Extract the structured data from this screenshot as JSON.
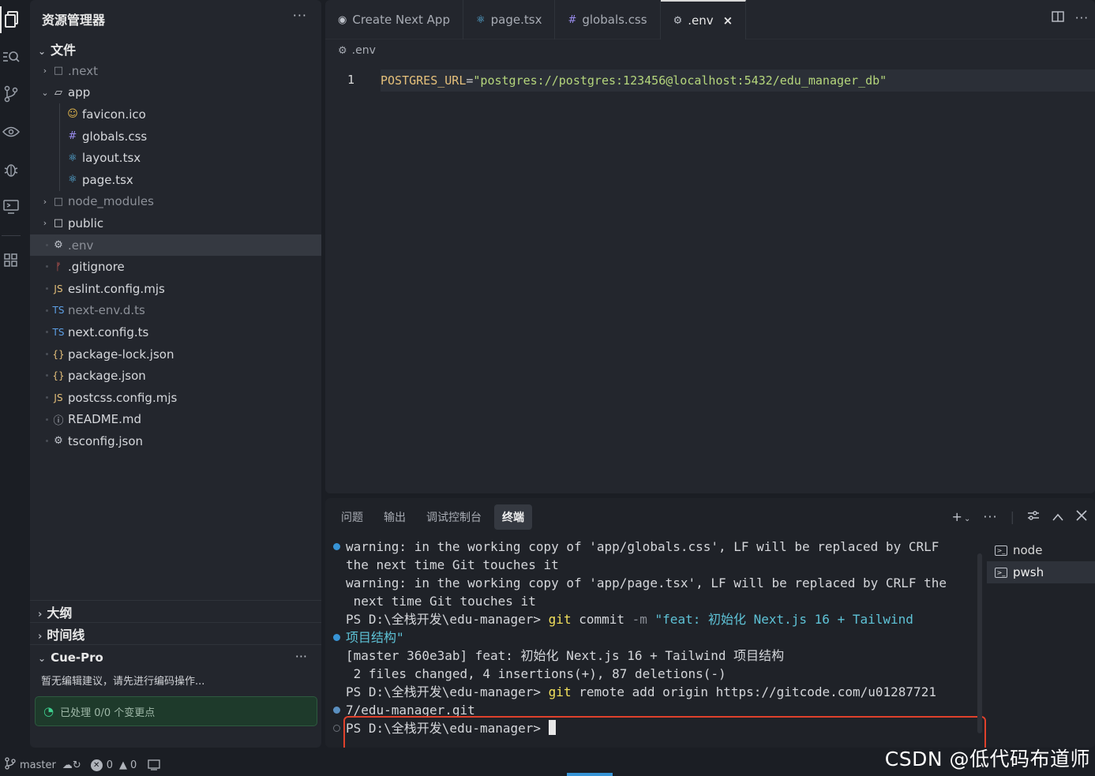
{
  "sidebar": {
    "title": "资源管理器",
    "more": "···",
    "section": "文件",
    "items": [
      {
        "name": "tree-folder-next",
        "label": ".next",
        "icon": "□",
        "chev": "›",
        "indent": 0,
        "dim": true
      },
      {
        "name": "tree-folder-app",
        "label": "app",
        "icon": "▱",
        "chev": "⌄",
        "indent": 0
      },
      {
        "name": "tree-file-favicon",
        "label": "favicon.ico",
        "icon": "☺",
        "iconColor": "#e5b84c",
        "indent": 1
      },
      {
        "name": "tree-file-globals",
        "label": "globals.css",
        "icon": "#",
        "iconColor": "#9b8df0",
        "indent": 1
      },
      {
        "name": "tree-file-layout",
        "label": "layout.tsx",
        "icon": "⚛",
        "iconColor": "#5ec2f6",
        "indent": 1
      },
      {
        "name": "tree-file-page",
        "label": "page.tsx",
        "icon": "⚛",
        "iconColor": "#5ec2f6",
        "indent": 1
      },
      {
        "name": "tree-folder-node-modules",
        "label": "node_modules",
        "icon": "□",
        "chev": "›",
        "indent": 0,
        "dim": true
      },
      {
        "name": "tree-folder-public",
        "label": "public",
        "icon": "□",
        "chev": "›",
        "indent": 0
      },
      {
        "name": "tree-file-env",
        "label": ".env",
        "icon": "⚙",
        "iconColor": "#c0c4cc",
        "indent": 0,
        "dim": true,
        "selected": true
      },
      {
        "name": "tree-file-gitignore",
        "label": ".gitignore",
        "icon": "ᚠ",
        "iconColor": "#e0605a",
        "indent": 0
      },
      {
        "name": "tree-file-eslint",
        "label": "eslint.config.mjs",
        "icon": "JS",
        "iconColor": "#e5c07b",
        "indent": 0
      },
      {
        "name": "tree-file-next-env",
        "label": "next-env.d.ts",
        "icon": "TS",
        "iconColor": "#5ea0e6",
        "indent": 0,
        "dim": true
      },
      {
        "name": "tree-file-next-config",
        "label": "next.config.ts",
        "icon": "TS",
        "iconColor": "#5ea0e6",
        "indent": 0
      },
      {
        "name": "tree-file-package-lock",
        "label": "package-lock.json",
        "icon": "{}",
        "iconColor": "#e5c07b",
        "indent": 0
      },
      {
        "name": "tree-file-package",
        "label": "package.json",
        "icon": "{}",
        "iconColor": "#e5c07b",
        "indent": 0
      },
      {
        "name": "tree-file-postcss",
        "label": "postcss.config.mjs",
        "icon": "JS",
        "iconColor": "#e5c07b",
        "indent": 0
      },
      {
        "name": "tree-file-readme",
        "label": "README.md",
        "icon": "ⓘ",
        "iconColor": "#c0c4cc",
        "indent": 0
      },
      {
        "name": "tree-file-tsconfig",
        "label": "tsconfig.json",
        "icon": "⚙",
        "iconColor": "#c0c4cc",
        "indent": 0
      }
    ],
    "outline": "大纲",
    "timeline": "时间线",
    "cue": {
      "title": "Cue-Pro",
      "more": "···",
      "message": "暂无编辑建议，请先进行编码操作...",
      "status": "已处理 0/0 个变更点"
    }
  },
  "editor": {
    "tabs": [
      {
        "label": "Create Next App",
        "icon": "◉",
        "iconColor": "#c0c4cc"
      },
      {
        "label": "page.tsx",
        "icon": "⚛",
        "iconColor": "#5ec2f6"
      },
      {
        "label": "globals.css",
        "icon": "#",
        "iconColor": "#9b8df0"
      },
      {
        "label": ".env",
        "icon": "⚙",
        "iconColor": "#c0c4cc",
        "active": true,
        "close": "×"
      }
    ],
    "breadcrumb": ".env",
    "line_number": "1",
    "code": {
      "key": "POSTGRES_URL",
      "op": "=",
      "value": "\"postgres://postgres:123456@localhost:5432/edu_manager_db\""
    }
  },
  "panel": {
    "tabs": [
      "问题",
      "输出",
      "调试控制台",
      "终端"
    ],
    "active_tab": "终端",
    "terminal": {
      "l1": "warning: in the working copy of 'app/globals.css', LF will be replaced by CRLF",
      "l2": "the next time Git touches it",
      "l3": "warning: in the working copy of 'app/page.tsx', LF will be replaced by CRLF the",
      "l4": " next time Git touches it",
      "l5_prompt": "PS D:\\全栈开发\\edu-manager> ",
      "l5_cmd": "git",
      "l5_rest": " commit ",
      "l5_flag": "-m",
      "l5_msg": " \"feat: 初始化 Next.js 16 + Tailwind",
      "l6_msg": "项目结构\"",
      "l7": "[master 360e3ab] feat: 初始化 Next.js 16 + Tailwind 项目结构",
      "l8": " 2 files changed, 4 insertions(+), 87 deletions(-)",
      "l9_prompt": "PS D:\\全栈开发\\edu-manager> ",
      "l9_cmd": "git",
      "l9_rest": " remote add origin https://gitcode.com/u01287721",
      "l10": "7/edu-manager.git",
      "l11_prompt": "PS D:\\全栈开发\\edu-manager> "
    },
    "terminals": [
      "node",
      "pwsh"
    ],
    "active_terminal": "pwsh"
  },
  "status": {
    "branch": "master",
    "errors": "0",
    "warnings": "0"
  },
  "watermark": "CSDN @低代码布道师"
}
